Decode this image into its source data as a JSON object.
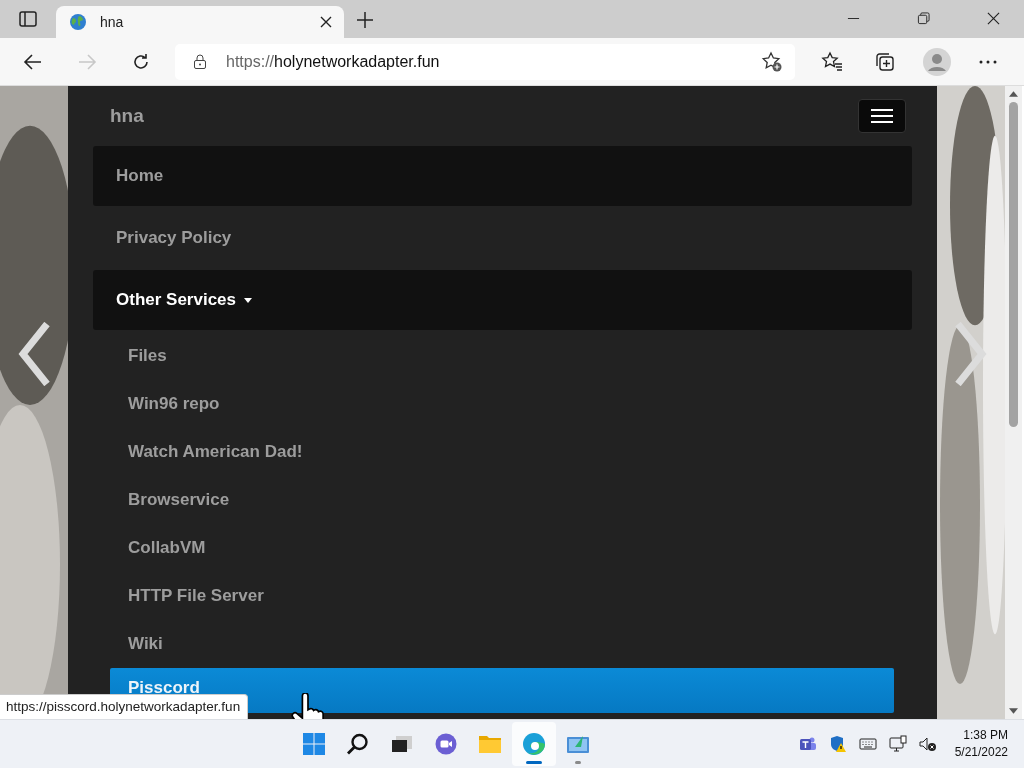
{
  "browser": {
    "tabs": [
      {
        "title": "hna",
        "selected": true
      }
    ],
    "forward_button": {
      "disabled": true
    },
    "address": {
      "scheme": "https://",
      "host": "holynetworkadapter.fun"
    }
  },
  "page": {
    "brand": "hna",
    "nav_items": [
      {
        "label": "Home",
        "active": true,
        "expanded": false
      },
      {
        "label": "Privacy Policy",
        "active": false,
        "expanded": false
      },
      {
        "label": "Other Services",
        "active": true,
        "expanded": true,
        "children": [
          {
            "label": "Files",
            "hovered": false
          },
          {
            "label": "Win96 repo",
            "hovered": false
          },
          {
            "label": "Watch American Dad!",
            "hovered": false
          },
          {
            "label": "Browservice",
            "hovered": false
          },
          {
            "label": "CollabVM",
            "hovered": false
          },
          {
            "label": "HTTP File Server",
            "hovered": false
          },
          {
            "label": "Wiki",
            "hovered": false
          },
          {
            "label": "Pisscord",
            "hovered": true
          }
        ]
      }
    ]
  },
  "status_url": "https://pisscord.holynetworkadapter.fun",
  "taskbar": {
    "apps": [
      {
        "kind": "start",
        "active": false,
        "running": false
      },
      {
        "kind": "search",
        "active": false,
        "running": false
      },
      {
        "kind": "taskview",
        "active": false,
        "running": false
      },
      {
        "kind": "chat",
        "active": false,
        "running": false
      },
      {
        "kind": "files",
        "active": false,
        "running": false
      },
      {
        "kind": "edge",
        "active": true,
        "running": true
      },
      {
        "kind": "app",
        "active": false,
        "running": true
      }
    ],
    "time": "1:38 PM",
    "date": "5/21/2022"
  }
}
